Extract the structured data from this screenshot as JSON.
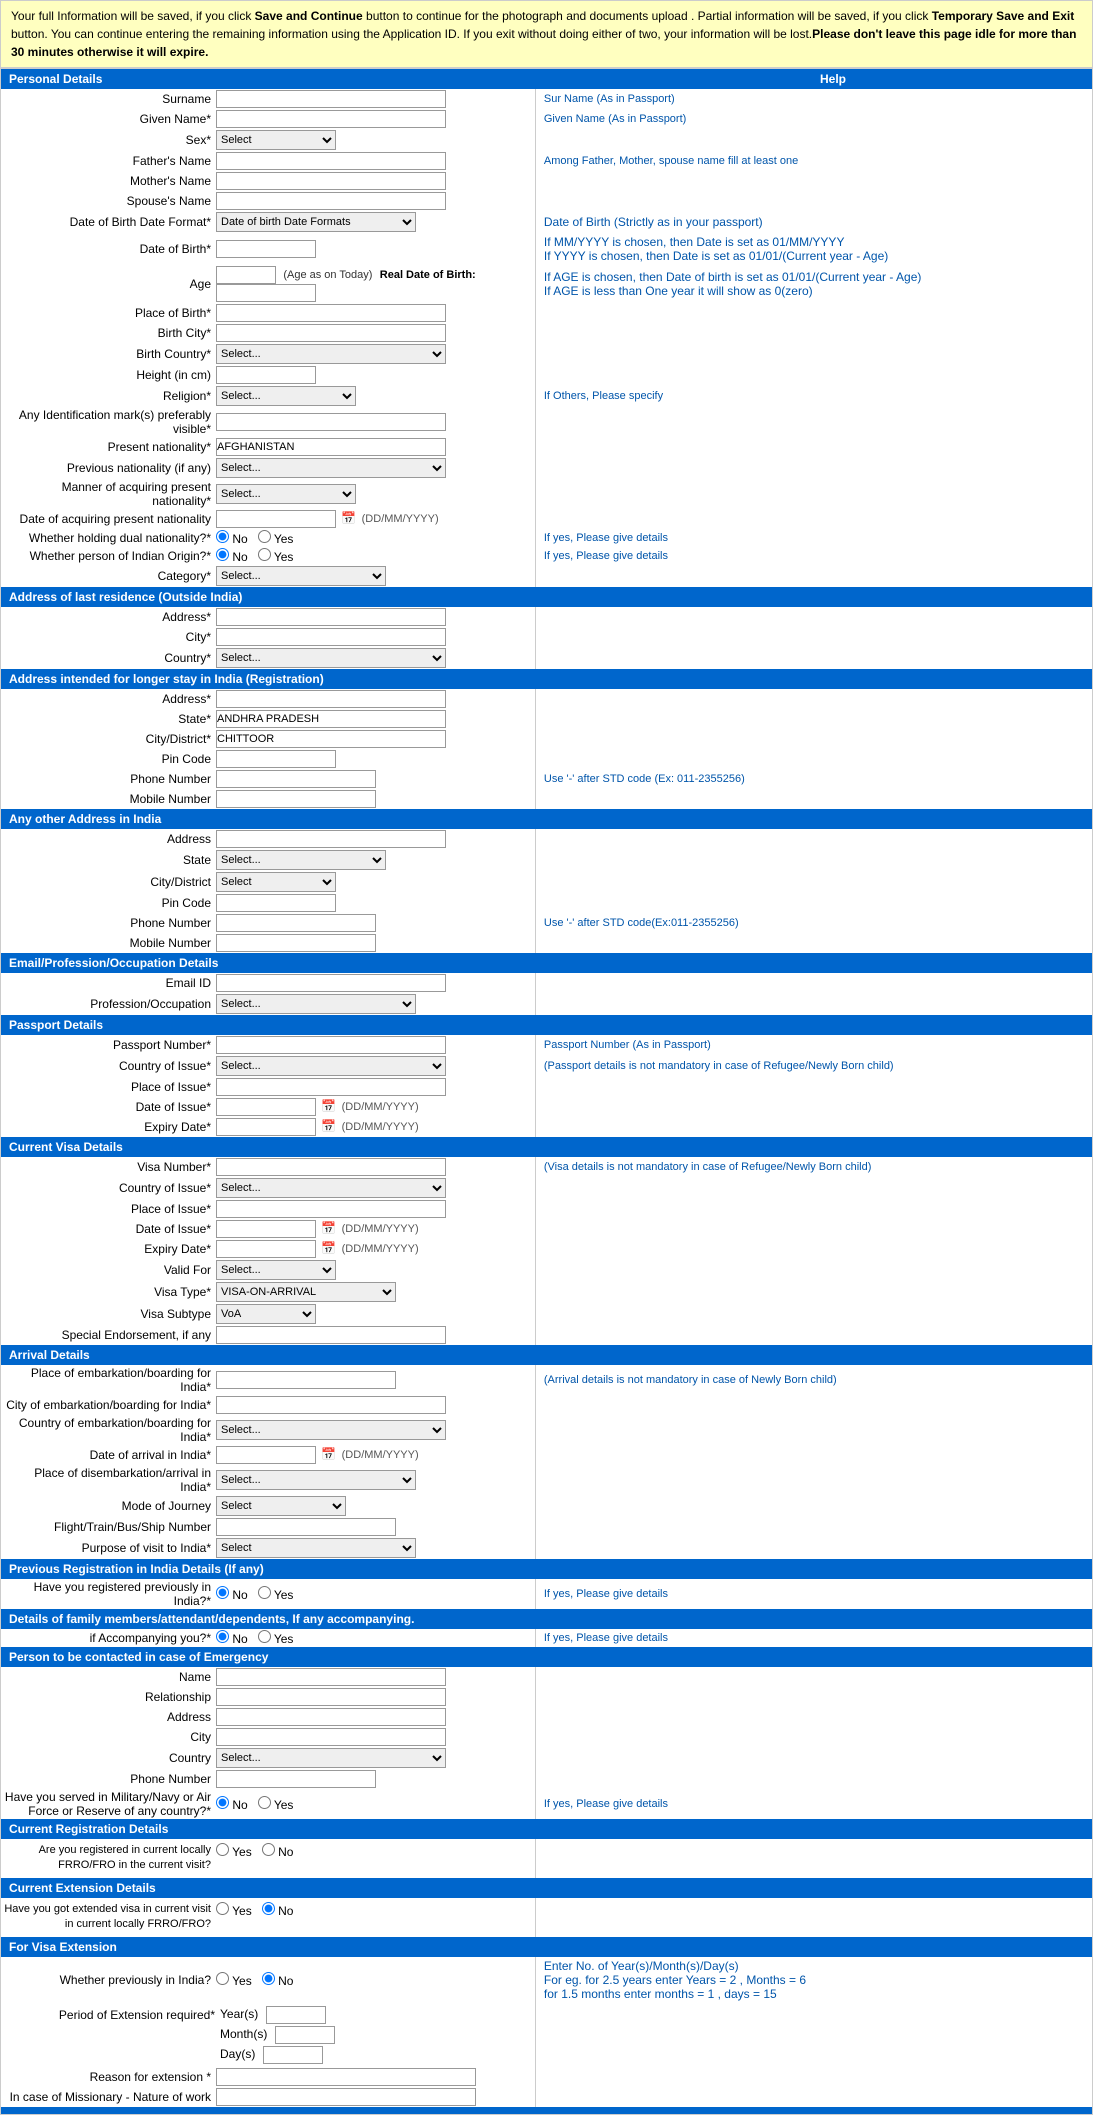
{
  "notice": {
    "text1": "Your full Information will be saved, if you click ",
    "bold1": "Save and Continue",
    "text2": " button to continue for the photograph and documents upload . Partial information will be saved, if you click ",
    "bold2": "Temporary Save and Exit",
    "text3": " button. You can continue entering the remaining information using the Application ID. If you exit without doing either of two, your information will be lost.",
    "bold3": "Please don't leave this page idle for more than 30 minutes otherwise it will expire."
  },
  "sections": {
    "personal": "Personal Details",
    "help": "Help",
    "address_last": "Address of last residence (Outside India)",
    "address_india": "Address intended for longer stay in India (Registration)",
    "any_other": "Any other Address in India",
    "email_prof": "Email/Profession/Occupation Details",
    "passport": "Passport Details",
    "visa": "Current Visa Details",
    "arrival": "Arrival Details",
    "prev_reg": "Previous Registration in India Details (If any)",
    "family": "Details of family members/attendant/dependents, If any accompanying.",
    "emergency": "Person to be contacted in case of Emergency",
    "current_reg": "Current Registration Details",
    "current_ext": "Current Extension Details",
    "visa_ext": "For Visa Extension"
  },
  "fields": {
    "surname": "Surname",
    "given_name": "Given Name*",
    "sex": "Sex*",
    "fathers_name": "Father's Name",
    "mothers_name": "Mother's Name",
    "spouses_name": "Spouse's Name",
    "dob_format": "Date of Birth Date Format*",
    "dob": "Date of Birth*",
    "age": "Age",
    "place_of_birth": "Place of Birth*",
    "birth_city": "Birth City*",
    "birth_country": "Birth Country*",
    "height": "Height (in cm)",
    "religion": "Religion*",
    "identification": "Any Identification mark(s) preferably visible*",
    "present_nationality": "Present nationality*",
    "previous_nationality": "Previous nationality (if any)",
    "manner_acquiring": "Manner of acquiring present nationality*",
    "date_acquiring": "Date of acquiring present nationality",
    "dual_nationality": "Whether holding dual nationality?*",
    "indian_origin": "Whether person of Indian Origin?*",
    "category": "Category*"
  },
  "help_texts": {
    "surname": "Sur Name (As in Passport)",
    "given_name": "Given Name (As in Passport)",
    "fathers_name_help": "Among Father, Mother, spouse name fill at least one",
    "dob_help1": "Date of Birth (Strictly as in your passport)",
    "dob_help2": "If MM/YYYY is chosen, then Date is set as 01/MM/YYYY",
    "dob_help3": "If YYYY is chosen, then Date is set as 01/01/(Current year - Age)",
    "dob_help4": "If AGE is chosen, then Date of birth is set as 01/01/(Current year - Age)",
    "dob_help5": "If AGE is less than One year it will show as 0(zero)",
    "religion_help": "If Others, Please specify",
    "dual_help": "If yes, Please give details",
    "indian_origin_help": "If yes, Please give details",
    "phone_help": "Use '-' after STD code (Ex: 011-2355256)",
    "phone_help2": "Use '-' after STD code(Ex:011-2355256)",
    "passport_help1": "Passport Number (As in Passport)",
    "passport_help2": "(Passport details is not mandatory in case of Refugee/Newly Born child)",
    "visa_help": "(Visa details is not mandatory in case of Refugee/Newly Born child)",
    "arrival_help": "(Arrival details is not mandatory in case of Newly Born child)",
    "prev_reg_help": "If yes, Please give details",
    "family_help": "If yes, Please give details",
    "military_help": "If yes, Please give details",
    "visa_ext_note1": "Enter No. of Year(s)/Month(s)/Day(s)",
    "visa_ext_note2": "For eg. for 2.5 years enter Years = 2 , Months = 6",
    "visa_ext_note3": "for 1.5 months enter months = 1 , days = 15"
  },
  "defaults": {
    "present_nationality": "AFGHANISTAN",
    "state_india": "ANDHRA PRADESH",
    "city_district": "CHITTOOR",
    "visa_type": "VISA-ON-ARRIVAL",
    "visa_subtype": "VoA"
  },
  "labels": {
    "no": "No",
    "yes": "Yes",
    "age_today": "(Age as on Today)",
    "real_dob": "Real Date of Birth:",
    "dd_mm_yyyy": "(DD/MM/YYYY)",
    "select": "Select...",
    "select_plain": "Select",
    "andhra": "ANDHRA PRADESH",
    "chittoor": "CHITTOOR",
    "afghanistan": "AFGHANISTAN",
    "visa_on_arrival": "VISA-ON-ARRIVAL",
    "voa": "VoA",
    "profession_select": "Select...",
    "purpose_select": "Select",
    "mode_select": "Select"
  }
}
